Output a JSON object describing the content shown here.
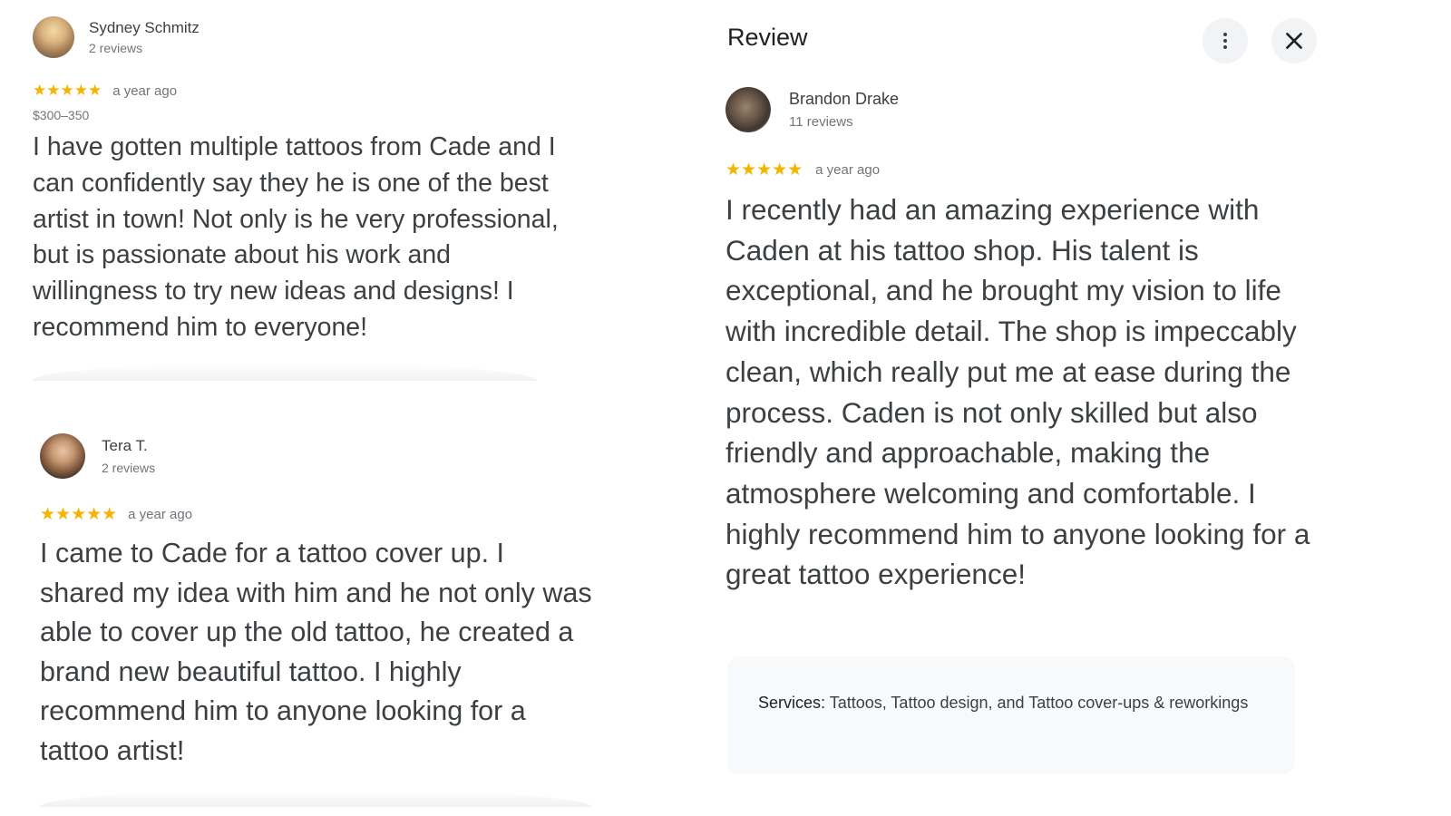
{
  "reviews": [
    {
      "name": "Sydney Schmitz",
      "review_count": "2 reviews",
      "rating": 5,
      "stars": "★★★★★",
      "time_ago": "a year ago",
      "price": "$300–350",
      "text": "I have gotten multiple tattoos from Cade and I can confidently say they he is one of the best artist in town! Not only is he very professional, but is passionate about his work and willingness to try new ideas and designs! I recommend him to everyone!"
    },
    {
      "name": "Tera T.",
      "review_count": "2 reviews",
      "rating": 5,
      "stars": "★★★★★",
      "time_ago": "a year ago",
      "text": "I came to Cade for a tattoo cover up. I shared my idea with him and he not only was able to cover up the old tattoo, he created a brand new beautiful tattoo. I highly recommend him to anyone looking for a tattoo artist!"
    }
  ],
  "detail": {
    "title": "Review",
    "more_icon": "more-vert-icon",
    "close_icon": "close-icon",
    "review": {
      "name": "Brandon Drake",
      "review_count": "11 reviews",
      "rating": 5,
      "stars": "★★★★★",
      "time_ago": "a year ago",
      "text": "I recently had an amazing experience with Caden at his tattoo shop. His talent is exceptional, and he brought my vision to life with incredible detail. The shop is impeccably clean, which really put me at ease during the process. Caden is not only skilled but also friendly and approachable, making the atmosphere welcoming and comfortable. I highly recommend him to anyone looking for a great tattoo experience!"
    },
    "services": {
      "label": "Services:",
      "value": "Tattoos, Tattoo design, and Tattoo cover-ups & reworkings"
    }
  },
  "colors": {
    "star": "#f4b400",
    "text": "#3c4043",
    "muted": "#70757a",
    "button_bg": "#f1f3f4",
    "services_bg": "#f8f9fa"
  }
}
